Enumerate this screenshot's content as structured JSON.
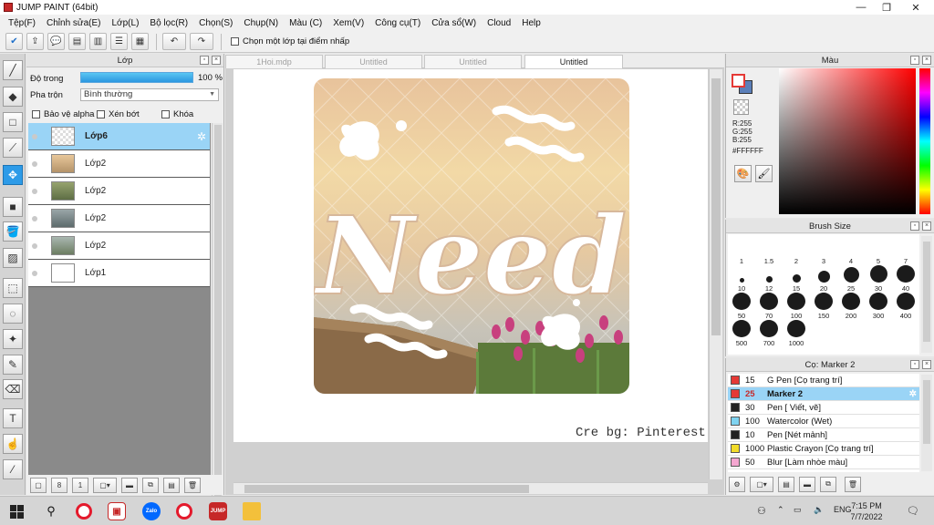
{
  "window": {
    "title": "JUMP PAINT (64bit)",
    "minimize": "—",
    "maximize": "❐",
    "close": "✕"
  },
  "menu": [
    "Tệp(F)",
    "Chỉnh sửa(E)",
    "Lớp(L)",
    "Bộ lọc(R)",
    "Chọn(S)",
    "Chụp(N)",
    "Màu (C)",
    "Xem(V)",
    "Công cụ(T)",
    "Cửa sổ(W)",
    "Cloud",
    "Help"
  ],
  "toolbar": {
    "pick_layer_label": "Chọn một lớp tại điểm nhấp"
  },
  "layer_panel": {
    "title": "Lớp",
    "opacity_label": "Độ trong",
    "opacity_value": "100 %",
    "opacity": 1.0,
    "blend_label": "Pha trộn",
    "blend_value": "Bình thường",
    "protect_alpha": "Bảo vệ alpha",
    "clipping": "Xén bớt",
    "lock": "Khóa",
    "layers": [
      {
        "name": "Lớp6",
        "selected": true,
        "thumb": "#f4f4f4"
      },
      {
        "name": "Lớp2",
        "selected": false,
        "thumb": "#d9b98e"
      },
      {
        "name": "Lớp2",
        "selected": false,
        "thumb": "#7f8f5e"
      },
      {
        "name": "Lớp2",
        "selected": false,
        "thumb": "#7d8a8a"
      },
      {
        "name": "Lớp2",
        "selected": false,
        "thumb": "#8c9a86"
      },
      {
        "name": "Lớp1",
        "selected": false,
        "thumb": "#ffffff"
      }
    ]
  },
  "document": {
    "tabs": [
      {
        "label": "1Hoi.mdp",
        "active": false
      },
      {
        "label": "Untitled",
        "active": false
      },
      {
        "label": "Untitled",
        "active": false
      },
      {
        "label": "Untitled",
        "active": true
      }
    ],
    "artwork_text": "Need",
    "credit_text": "Cre bg: Pinterest"
  },
  "color_panel": {
    "title": "Màu",
    "r": "R:255",
    "g": "G:255",
    "b": "B:255",
    "hex": "#FFFFFF",
    "fg_color": "#ffffff",
    "bg_color": "#5b7fb9"
  },
  "brush_panel": {
    "title": "Brush Size",
    "sizes": [
      "1",
      "1.5",
      "2",
      "3",
      "4",
      "5",
      "7",
      "10",
      "12",
      "15",
      "20",
      "25",
      "30",
      "40",
      "50",
      "70",
      "100",
      "150",
      "200",
      "300",
      "400",
      "500",
      "700",
      "1000"
    ]
  },
  "tool_panel": {
    "title": "Cọ: Marker 2",
    "tools": [
      {
        "size": "15",
        "name": "G Pen [Cọ trang trí]",
        "color": "#e53935",
        "selected": false
      },
      {
        "size": "25",
        "name": "Marker 2",
        "color": "#e53935",
        "selected": true
      },
      {
        "size": "30",
        "name": "Pen [ Viết, vẽ]",
        "color": "#222222",
        "selected": false
      },
      {
        "size": "100",
        "name": "Watercolor (Wet)",
        "color": "#7fd3f0",
        "selected": false
      },
      {
        "size": "10",
        "name": "Pen [Nét mảnh]",
        "color": "#222222",
        "selected": false
      },
      {
        "size": "1000",
        "name": "Plastic Crayon [Cọ trang trí]",
        "color": "#f2dc2a",
        "selected": false
      },
      {
        "size": "50",
        "name": "Blur [Làm nhòe màu]",
        "color": "#f4a6d0",
        "selected": false
      }
    ]
  },
  "taskbar": {
    "language": "ENG",
    "time": "7:15 PM",
    "date": "7/7/2022",
    "app_zalo": "Zalo",
    "app_jump": "JUMP"
  }
}
